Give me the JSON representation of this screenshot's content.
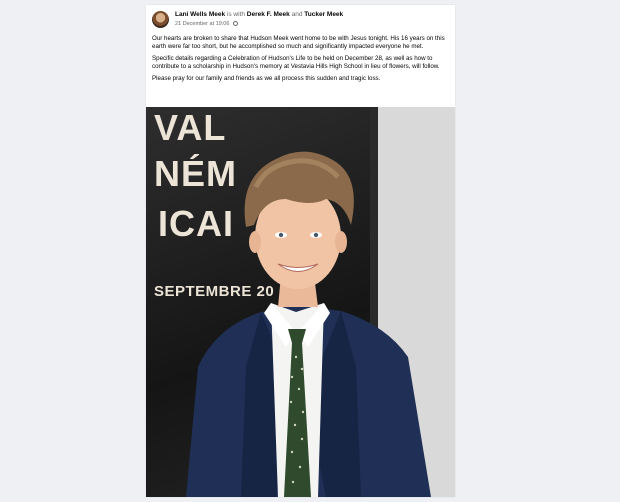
{
  "post": {
    "author": "Lani Wells Meek",
    "is_with": "is with",
    "tagged_1": "Derek F. Meek",
    "and": "and",
    "tagged_2": "Tucker Meek",
    "timestamp": "21 December at 19:06",
    "paragraphs": [
      "Our hearts are broken to share that Hudson Meek went home to be with Jesus tonight. His 16 years on this earth were far too short, but he accomplished so much and significantly impacted everyone he met.",
      "Specific details regarding a Celebration of Hudson's Life to be held on December 28, as well as how to contribute to a scholarship in Hudson's memory at Vestavia Hills High School in lieu of flowers, will follow.",
      "Please pray for our family and friends as we all process this sudden and tragic loss."
    ]
  },
  "photo": {
    "banner_lines": [
      "VAL",
      "NÉM",
      "ICAI",
      "SEPTEMBRE 20"
    ]
  },
  "colors": {
    "background": "#eef0f3",
    "card": "#ffffff",
    "name": "#050505",
    "meta": "#65676b"
  }
}
